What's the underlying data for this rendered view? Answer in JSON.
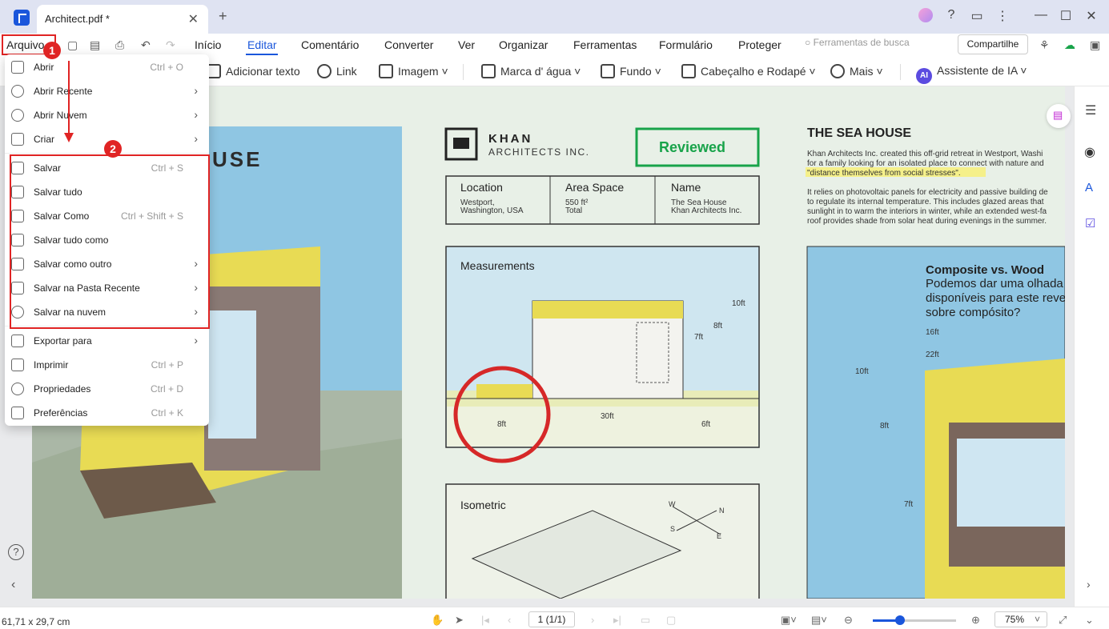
{
  "titlebar": {
    "tab_title": "Architect.pdf *",
    "tab_close": "✕",
    "new_tab": "+"
  },
  "menubar": {
    "items": [
      "Arquivo",
      "Início",
      "Editar",
      "Comentário",
      "Converter",
      "Ver",
      "Organizar",
      "Ferramentas",
      "Formulário",
      "Proteger"
    ],
    "active": "Editar",
    "search_placeholder": "Ferramentas de busca",
    "share_label": "Compartilhe"
  },
  "toolbar": {
    "tools": [
      "Adicionar texto",
      "Link",
      "Imagem",
      "Marca d' água",
      "Fundo",
      "Cabeçalho e Rodapé",
      "Mais",
      "Assistente de IA"
    ]
  },
  "dropdown": {
    "items": [
      {
        "label": "Abrir",
        "shortcut": "Ctrl + O",
        "submenu": false
      },
      {
        "label": "Abrir Recente",
        "shortcut": "",
        "submenu": true
      },
      {
        "label": "Abrir Nuvem",
        "shortcut": "",
        "submenu": true
      },
      {
        "label": "Criar",
        "shortcut": "",
        "submenu": true
      },
      {
        "label": "Salvar",
        "shortcut": "Ctrl + S",
        "submenu": false
      },
      {
        "label": "Salvar tudo",
        "shortcut": "",
        "submenu": false
      },
      {
        "label": "Salvar Como",
        "shortcut": "Ctrl + Shift + S",
        "submenu": false
      },
      {
        "label": "Salvar tudo como",
        "shortcut": "",
        "submenu": false
      },
      {
        "label": "Salvar como outro",
        "shortcut": "",
        "submenu": true
      },
      {
        "label": "Salvar na Pasta Recente",
        "shortcut": "",
        "submenu": true
      },
      {
        "label": "Salvar na nuvem",
        "shortcut": "",
        "submenu": true
      },
      {
        "label": "Exportar para",
        "shortcut": "",
        "submenu": true
      },
      {
        "label": "Imprimir",
        "shortcut": "Ctrl + P",
        "submenu": false
      },
      {
        "label": "Propriedades",
        "shortcut": "Ctrl + D",
        "submenu": false
      },
      {
        "label": "Preferências",
        "shortcut": "Ctrl + K",
        "submenu": false
      }
    ]
  },
  "annotations": {
    "badge1": "1",
    "badge2": "2"
  },
  "document": {
    "house_heading": "HOUSE",
    "khan_title": "KHAN",
    "khan_subtitle": "ARCHITECTS INC.",
    "reviewed": "Reviewed",
    "location_label": "Location",
    "location_value_1": "Westport,",
    "location_value_2": "Washington, USA",
    "area_label": "Area Space",
    "area_value_1": "550 ft²",
    "area_value_2": "Total",
    "name_label": "Name",
    "name_value_1": "The Sea House",
    "name_value_2": "Khan Architects Inc.",
    "sea_house_title": "THE SEA HOUSE",
    "desc_1": "Khan Architects Inc. created this off-grid retreat in Westport, Washi",
    "desc_2": "for a family looking for an isolated place to connect with nature and",
    "desc_3": "\"distance themselves from social stresses\".",
    "desc_4": "It relies on photovoltaic panels for electricity and passive building de",
    "desc_5": "to regulate its internal temperature. This includes glazed areas that",
    "desc_6": "sunlight in to warm the interiors in winter, while an extended west-fa",
    "desc_7": "roof provides shade from solar heat during evenings in the summer.",
    "measurements": "Measurements",
    "m_10ft": "10ft",
    "m_8ft": "8ft",
    "m_7ft": "7ft",
    "m_30ft": "30ft",
    "m_8ft_b": "8ft",
    "m_6ft": "6ft",
    "isometric": "Isometric",
    "compass_w": "W",
    "compass_n": "N",
    "compass_s": "S",
    "compass_e": "E",
    "composite_title": "Composite vs. Wood",
    "composite_1": "Podemos dar uma olhada",
    "composite_2": "disponíveis para este reve",
    "composite_3": "sobre compósito?",
    "r_16ft": "16ft",
    "r_22ft": "22ft",
    "r_10ft": "10ft",
    "r_8ft": "8ft",
    "r_7ft": "7ft"
  },
  "statusbar": {
    "page_dims": "61,71 x 29,7 cm",
    "page_indicator": "1 (1/1)",
    "zoom": "75%",
    "zoom_fraction": 0.33
  },
  "colors": {
    "accent": "#1a56db",
    "annotation_red": "#e02424",
    "reviewed_green": "#18a34a"
  }
}
